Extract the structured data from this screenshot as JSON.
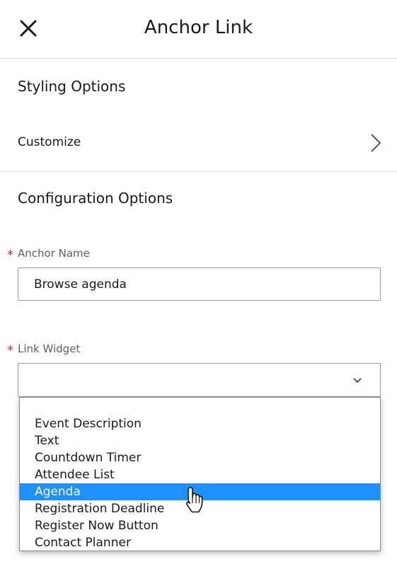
{
  "header": {
    "title": "Anchor Link",
    "close_icon": "close-icon"
  },
  "styling": {
    "title": "Styling Options",
    "customize_label": "Customize",
    "chevron_icon": "chevron-right-icon"
  },
  "config": {
    "title": "Configuration Options",
    "anchor_name": {
      "required_mark": "*",
      "label": "Anchor Name",
      "value": "Browse agenda"
    },
    "link_widget": {
      "required_mark": "*",
      "label": "Link Widget",
      "value": "",
      "chevron_icon": "chevron-down-icon",
      "options": [
        "Event Description",
        "Text",
        "Countdown Timer",
        "Attendee List",
        "Agenda",
        "Registration Deadline",
        "Register Now Button",
        "Contact Planner"
      ],
      "highlighted_option": "Agenda"
    }
  },
  "colors": {
    "highlight": "#1e90ff",
    "required": "#c0392b",
    "divider": "#dcdcdc",
    "label_text": "#5f5f5f"
  },
  "cursor_icon": "hand-pointer-icon"
}
